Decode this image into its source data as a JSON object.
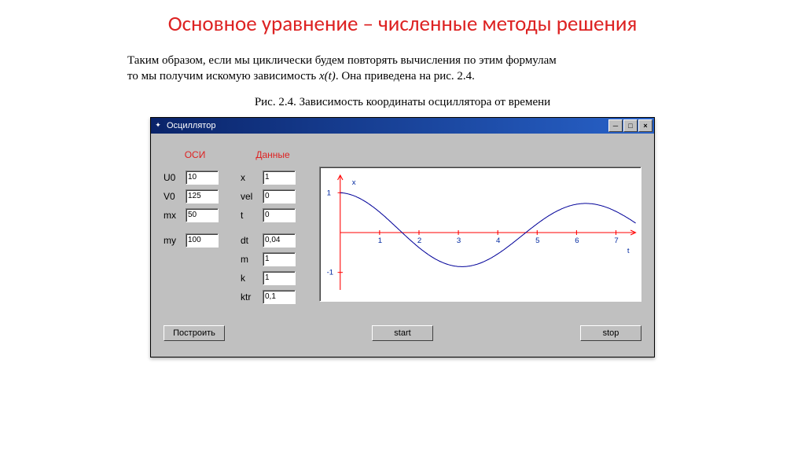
{
  "title": "Основное уравнение – численные методы решения",
  "description_line1": "Таким образом, если мы циклически будем повторять вычисления по этим формулам",
  "description_line2_before": "то мы получим искомую зависимость ",
  "description_line2_italic": "x(t)",
  "description_line2_after": ". Она приведена на рис. 2.4.",
  "figure_caption": "Рис. 2.4. Зависимость координаты осциллятора от времени",
  "window": {
    "title": "Осциллятор",
    "col_axes_header": "ОСИ",
    "col_data_header": "Данные",
    "axes": {
      "U0": {
        "label": "U0",
        "value": "10"
      },
      "V0": {
        "label": "V0",
        "value": "125"
      },
      "mx": {
        "label": "mx",
        "value": "50"
      },
      "my": {
        "label": "my",
        "value": "100"
      }
    },
    "data": {
      "x": {
        "label": "x",
        "value": "1"
      },
      "vel": {
        "label": "vel",
        "value": "0"
      },
      "t": {
        "label": "t",
        "value": "0"
      },
      "dt": {
        "label": "dt",
        "value": "0,04"
      },
      "m": {
        "label": "m",
        "value": "1"
      },
      "k": {
        "label": "k",
        "value": "1"
      },
      "ktr": {
        "label": "ktr",
        "value": "0,1"
      }
    },
    "buttons": {
      "build": "Построить",
      "start": "start",
      "stop": "stop"
    }
  },
  "chart_data": {
    "type": "line",
    "title": "",
    "xlabel": "t",
    "ylabel": "x",
    "xlim": [
      0,
      7.5
    ],
    "ylim": [
      -1.2,
      1.2
    ],
    "x_ticks": [
      1,
      2,
      3,
      4,
      5,
      6,
      7
    ],
    "y_ticks": [
      -1,
      1
    ],
    "series": [
      {
        "name": "x(t)",
        "description": "damped oscillation, x(t) ≈ exp(-0.05 t) cos(t)",
        "points_sampled": [
          {
            "t": 0.0,
            "x": 1.0
          },
          {
            "t": 0.5,
            "x": 0.86
          },
          {
            "t": 1.0,
            "x": 0.51
          },
          {
            "t": 1.5,
            "x": 0.07
          },
          {
            "t": 2.0,
            "x": -0.38
          },
          {
            "t": 2.5,
            "x": -0.71
          },
          {
            "t": 3.0,
            "x": -0.85
          },
          {
            "t": 3.5,
            "x": -0.78
          },
          {
            "t": 4.0,
            "x": -0.54
          },
          {
            "t": 4.5,
            "x": -0.17
          },
          {
            "t": 5.0,
            "x": 0.22
          },
          {
            "t": 5.5,
            "x": 0.54
          },
          {
            "t": 6.0,
            "x": 0.71
          },
          {
            "t": 6.5,
            "x": 0.71
          },
          {
            "t": 7.0,
            "x": 0.53
          },
          {
            "t": 7.5,
            "x": 0.24
          }
        ]
      }
    ]
  }
}
